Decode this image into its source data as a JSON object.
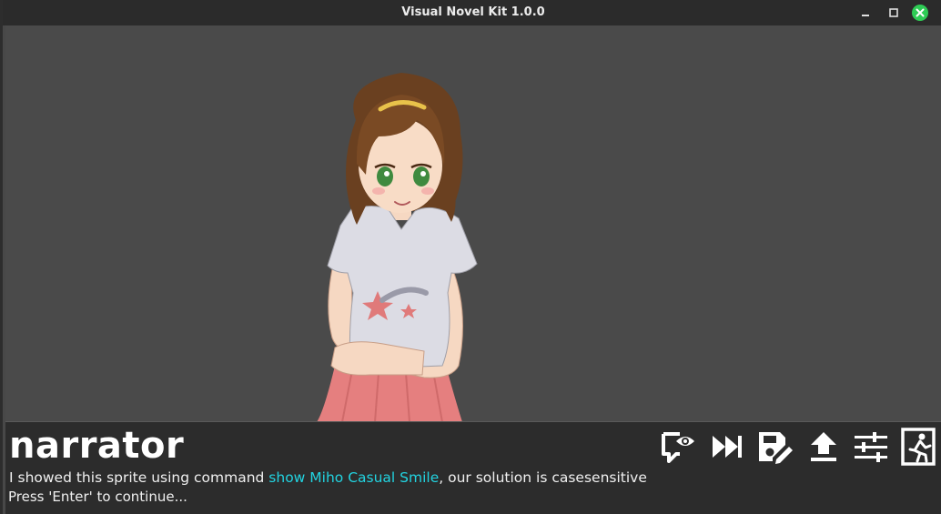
{
  "window": {
    "title": "Visual Novel Kit 1.0.0"
  },
  "dialog": {
    "speaker": "narrator",
    "text_before": "I showed this sprite using command ",
    "command": "show Miho Casual Smile",
    "text_after": ", our solution is casesensitive",
    "prompt": "Press 'Enter' to continue..."
  },
  "toolbar": [
    {
      "icon": "preview-comment-icon"
    },
    {
      "icon": "skip-forward-icon"
    },
    {
      "icon": "save-edit-icon"
    },
    {
      "icon": "load-upload-icon"
    },
    {
      "icon": "settings-sliders-icon"
    },
    {
      "icon": "exit-door-icon"
    }
  ],
  "colors": {
    "command_highlight": "#22d3e0",
    "close_button": "#2ecc55",
    "stage_background": "#4a4a4a",
    "dialog_background": "#2c2c2c"
  }
}
